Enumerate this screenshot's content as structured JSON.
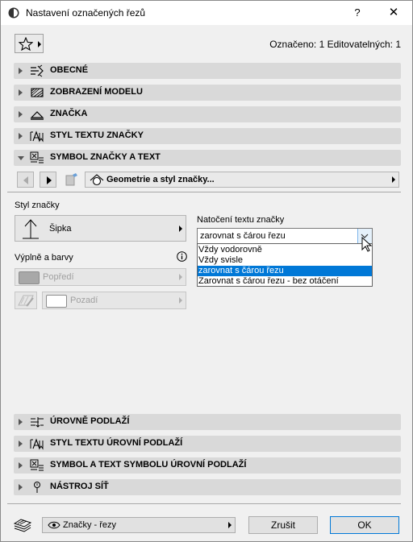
{
  "window": {
    "title": "Nastavení označených řezů",
    "help": "?",
    "close": "✕"
  },
  "header": {
    "selected_info": "Označeno: 1 Editovatelných: 1"
  },
  "panels_top": [
    {
      "label": "OBECNÉ",
      "icon": "general-settings-icon"
    },
    {
      "label": "ZOBRAZENÍ MODELU",
      "icon": "model-display-icon"
    },
    {
      "label": "ZNAČKA",
      "icon": "marker-icon"
    },
    {
      "label": "STYL TEXTU ZNAČKY",
      "icon": "text-style-icon"
    },
    {
      "label": "SYMBOL ZNAČKY A TEXT",
      "icon": "marker-symbol-icon",
      "expanded": true
    }
  ],
  "nav": {
    "geometry_label": "Geometrie a styl značky..."
  },
  "marker": {
    "style_label": "Styl značky",
    "style_value": "Šipka",
    "fills_label": "Výplně a barvy",
    "foreground": "Popředí",
    "background": "Pozadí"
  },
  "rotation": {
    "label": "Natočení textu značky",
    "value": "zarovnat s čárou řezu",
    "options": [
      "Vždy vodorovně",
      "Vždy svisle",
      "zarovnat s čárou řezu",
      "Zarovnat s čárou řezu - bez otáčení"
    ],
    "selected_index": 2
  },
  "panels_bottom": [
    {
      "label": "ÚROVNĚ PODLAŽÍ",
      "icon": "story-levels-icon"
    },
    {
      "label": "STYL TEXTU ÚROVNÍ PODLAŽÍ",
      "icon": "text-style-icon"
    },
    {
      "label": "SYMBOL A TEXT SYMBOLU ÚROVNÍ PODLAŽÍ",
      "icon": "marker-symbol-icon"
    },
    {
      "label": "NÁSTROJ SÍŤ",
      "icon": "grid-tool-icon"
    }
  ],
  "footer": {
    "favorites": "Značky - řezy",
    "cancel": "Zrušit",
    "ok": "OK"
  },
  "colors": {
    "panel_bg": "#d9d9d9",
    "selection": "#0078d7"
  }
}
